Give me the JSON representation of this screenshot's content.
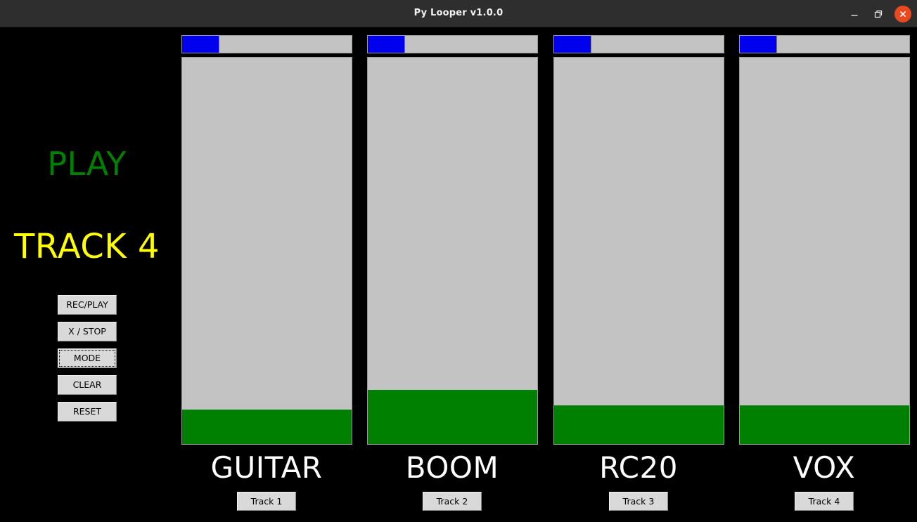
{
  "window": {
    "title": "Py Looper v1.0.0",
    "controls": {
      "minimize_name": "minimize-icon",
      "maximize_name": "maximize-icon",
      "close_name": "close-icon"
    },
    "colors": {
      "titlebar_bg": "#2e2e2e",
      "close_button": "#e8491f",
      "app_bg": "#000000"
    }
  },
  "control_panel": {
    "status_mode": "PLAY",
    "status_mode_color": "#008000",
    "selected_track": "TRACK 4",
    "selected_track_color": "#ffff00",
    "buttons": [
      {
        "label": "REC/PLAY",
        "focused": false
      },
      {
        "label": "X / STOP",
        "focused": false
      },
      {
        "label": "MODE",
        "focused": true
      },
      {
        "label": "CLEAR",
        "focused": false
      },
      {
        "label": "RESET",
        "focused": false
      }
    ]
  },
  "tracks": [
    {
      "name": "GUITAR",
      "button_label": "Track 1",
      "progress_percent": 22,
      "level_percent": 9,
      "progress_color": "#0000ee",
      "level_color": "#008000"
    },
    {
      "name": "BOOM",
      "button_label": "Track 2",
      "progress_percent": 22,
      "level_percent": 14,
      "progress_color": "#0000ee",
      "level_color": "#008000"
    },
    {
      "name": "RC20",
      "button_label": "Track 3",
      "progress_percent": 22,
      "level_percent": 10,
      "progress_color": "#0000ee",
      "level_color": "#008000"
    },
    {
      "name": "VOX",
      "button_label": "Track 4",
      "progress_percent": 22,
      "level_percent": 10,
      "progress_color": "#0000ee",
      "level_color": "#008000"
    }
  ]
}
